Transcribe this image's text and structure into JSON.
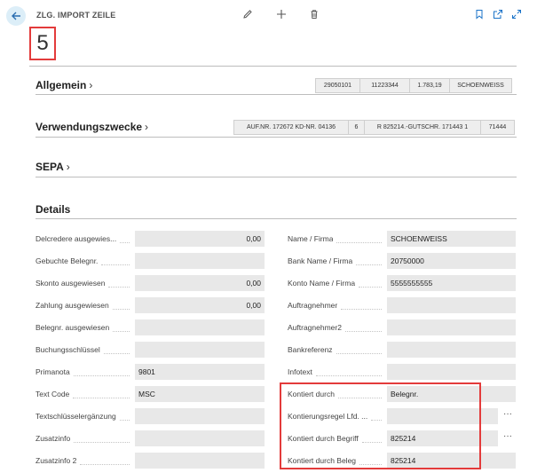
{
  "header": {
    "caption": "ZLG. IMPORT ZEILE",
    "record_no": "5",
    "icons": {
      "back": "arrow-left-icon",
      "edit": "pencil-icon",
      "new": "plus-icon",
      "delete": "trash-icon",
      "bookmark": "bookmark-icon",
      "open_new_window": "open-new-window-icon",
      "expand": "expand-icon"
    }
  },
  "sections": {
    "allgemein": {
      "title": "Allgemein",
      "chips": [
        "29050101",
        "11223344",
        "1.783,19",
        "SCHOENWEISS"
      ]
    },
    "verwendungszwecke": {
      "title": "Verwendungszwecke",
      "chips": [
        "AUF.NR. 172672 KD-NR. 04136",
        "6",
        "R 825214.-GUTSCHR. 171443 1",
        "71444"
      ]
    },
    "sepa": {
      "title": "SEPA"
    },
    "details": {
      "title": "Details",
      "left_fields": [
        {
          "label": "Delcredere ausgewies...",
          "value": "0,00"
        },
        {
          "label": "Gebuchte Belegnr.",
          "value": ""
        },
        {
          "label": "Skonto ausgewiesen",
          "value": "0,00"
        },
        {
          "label": "Zahlung ausgewiesen",
          "value": "0,00"
        },
        {
          "label": "Belegnr. ausgewiesen",
          "value": ""
        },
        {
          "label": "Buchungsschlüssel",
          "value": ""
        },
        {
          "label": "Primanota",
          "value": "9801"
        },
        {
          "label": "Text Code",
          "value": "MSC"
        },
        {
          "label": "Textschlüsselergänzung",
          "value": ""
        },
        {
          "label": "Zusatzinfo",
          "value": ""
        },
        {
          "label": "Zusatzinfo 2",
          "value": ""
        }
      ],
      "right_fields": [
        {
          "label": "Name / Firma",
          "value": "SCHOENWEISS"
        },
        {
          "label": "Bank Name / Firma",
          "value": "20750000"
        },
        {
          "label": "Konto Name / Firma",
          "value": "5555555555"
        },
        {
          "label": "Auftragnehmer",
          "value": ""
        },
        {
          "label": "Auftragnehmer2",
          "value": ""
        },
        {
          "label": "Bankreferenz",
          "value": ""
        },
        {
          "label": "Infotext",
          "value": ""
        },
        {
          "label": "Kontiert durch",
          "value": "Belegnr."
        },
        {
          "label": "Kontierungsregel Lfd. ...",
          "value": "",
          "more": "···"
        },
        {
          "label": "Kontiert durch Begriff",
          "value": "825214",
          "more": "···"
        },
        {
          "label": "Kontiert durch Beleg",
          "value": "825214"
        }
      ]
    }
  },
  "colors": {
    "accent": "#1a73c8",
    "highlight": "#e33b3b",
    "field_bg": "#e8e8e8"
  }
}
